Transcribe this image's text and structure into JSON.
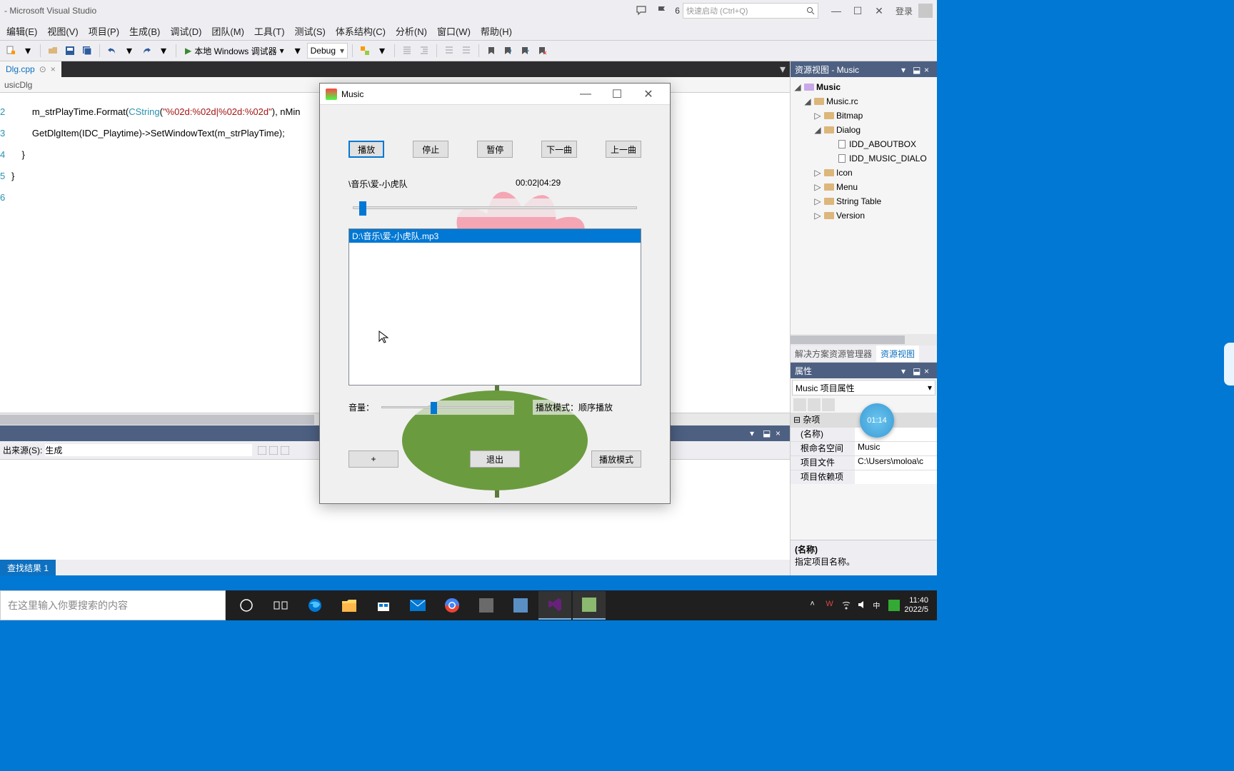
{
  "titlebar": {
    "title": " - Microsoft Visual Studio",
    "notif_count": "6",
    "quick_launch_placeholder": "快速启动 (Ctrl+Q)",
    "login": "登录"
  },
  "menu": [
    "编辑(E)",
    "视图(V)",
    "项目(P)",
    "生成(B)",
    "调试(D)",
    "团队(M)",
    "工具(T)",
    "测试(S)",
    "体系结构(C)",
    "分析(N)",
    "窗口(W)",
    "帮助(H)"
  ],
  "toolbar": {
    "debugger_label": "本地 Windows 调试器",
    "config": "Debug"
  },
  "tabs": {
    "active": "Dlg.cpp"
  },
  "nav": {
    "scope": "usicDlg"
  },
  "code": {
    "l1": "        m_strPlayTime.Format(CString(\"%02d:%02d|%02d:%02d\"), nMin",
    "l2": "        GetDlgItem(IDC_Playtime)->SetWindowText(m_strPlayTime);",
    "l3": "    }",
    "l4": "}"
  },
  "output": {
    "title": "",
    "source_label": "出来源(S):",
    "source_value": "生成"
  },
  "bottom_tab": "查找结果 1",
  "resource_view": {
    "title": "资源视图 - Music",
    "root": "Music",
    "rc": "Music.rc",
    "folders": [
      "Bitmap",
      "Dialog",
      "Icon",
      "Menu",
      "String Table",
      "Version"
    ],
    "dialogs": [
      "IDD_ABOUTBOX",
      "IDD_MUSIC_DIALO"
    ]
  },
  "panel_tabs": {
    "left": "解决方案资源管理器",
    "right": "资源视图"
  },
  "props": {
    "title": "属性",
    "object": "Music 项目属性",
    "cat": "杂项",
    "rows": [
      {
        "k": "(名称)",
        "v": ""
      },
      {
        "k": "根命名空间",
        "v": "Music"
      },
      {
        "k": "项目文件",
        "v": "C:\\Users\\moloa\\c"
      },
      {
        "k": "项目依赖项",
        "v": ""
      }
    ],
    "desc_title": "(名称)",
    "desc_text": "指定项目名称。"
  },
  "music": {
    "title": "Music",
    "buttons": {
      "play": "播放",
      "stop": "停止",
      "pause": "暂停",
      "next": "下一曲",
      "prev": "上一曲"
    },
    "song": "\\音乐\\爱-小虎队",
    "time": "00:02|04:29",
    "playlist_item": "D:\\音乐\\爱-小虎队.mp3",
    "volume_label": "音量：",
    "mode_label": "播放模式：顺序播放",
    "add": "+",
    "exit": "退出",
    "mode_btn": "播放模式"
  },
  "clock": "01:14",
  "taskbar": {
    "search_placeholder": "在这里输入你要搜索的内容",
    "time": "11:40",
    "date": "2022/5"
  }
}
